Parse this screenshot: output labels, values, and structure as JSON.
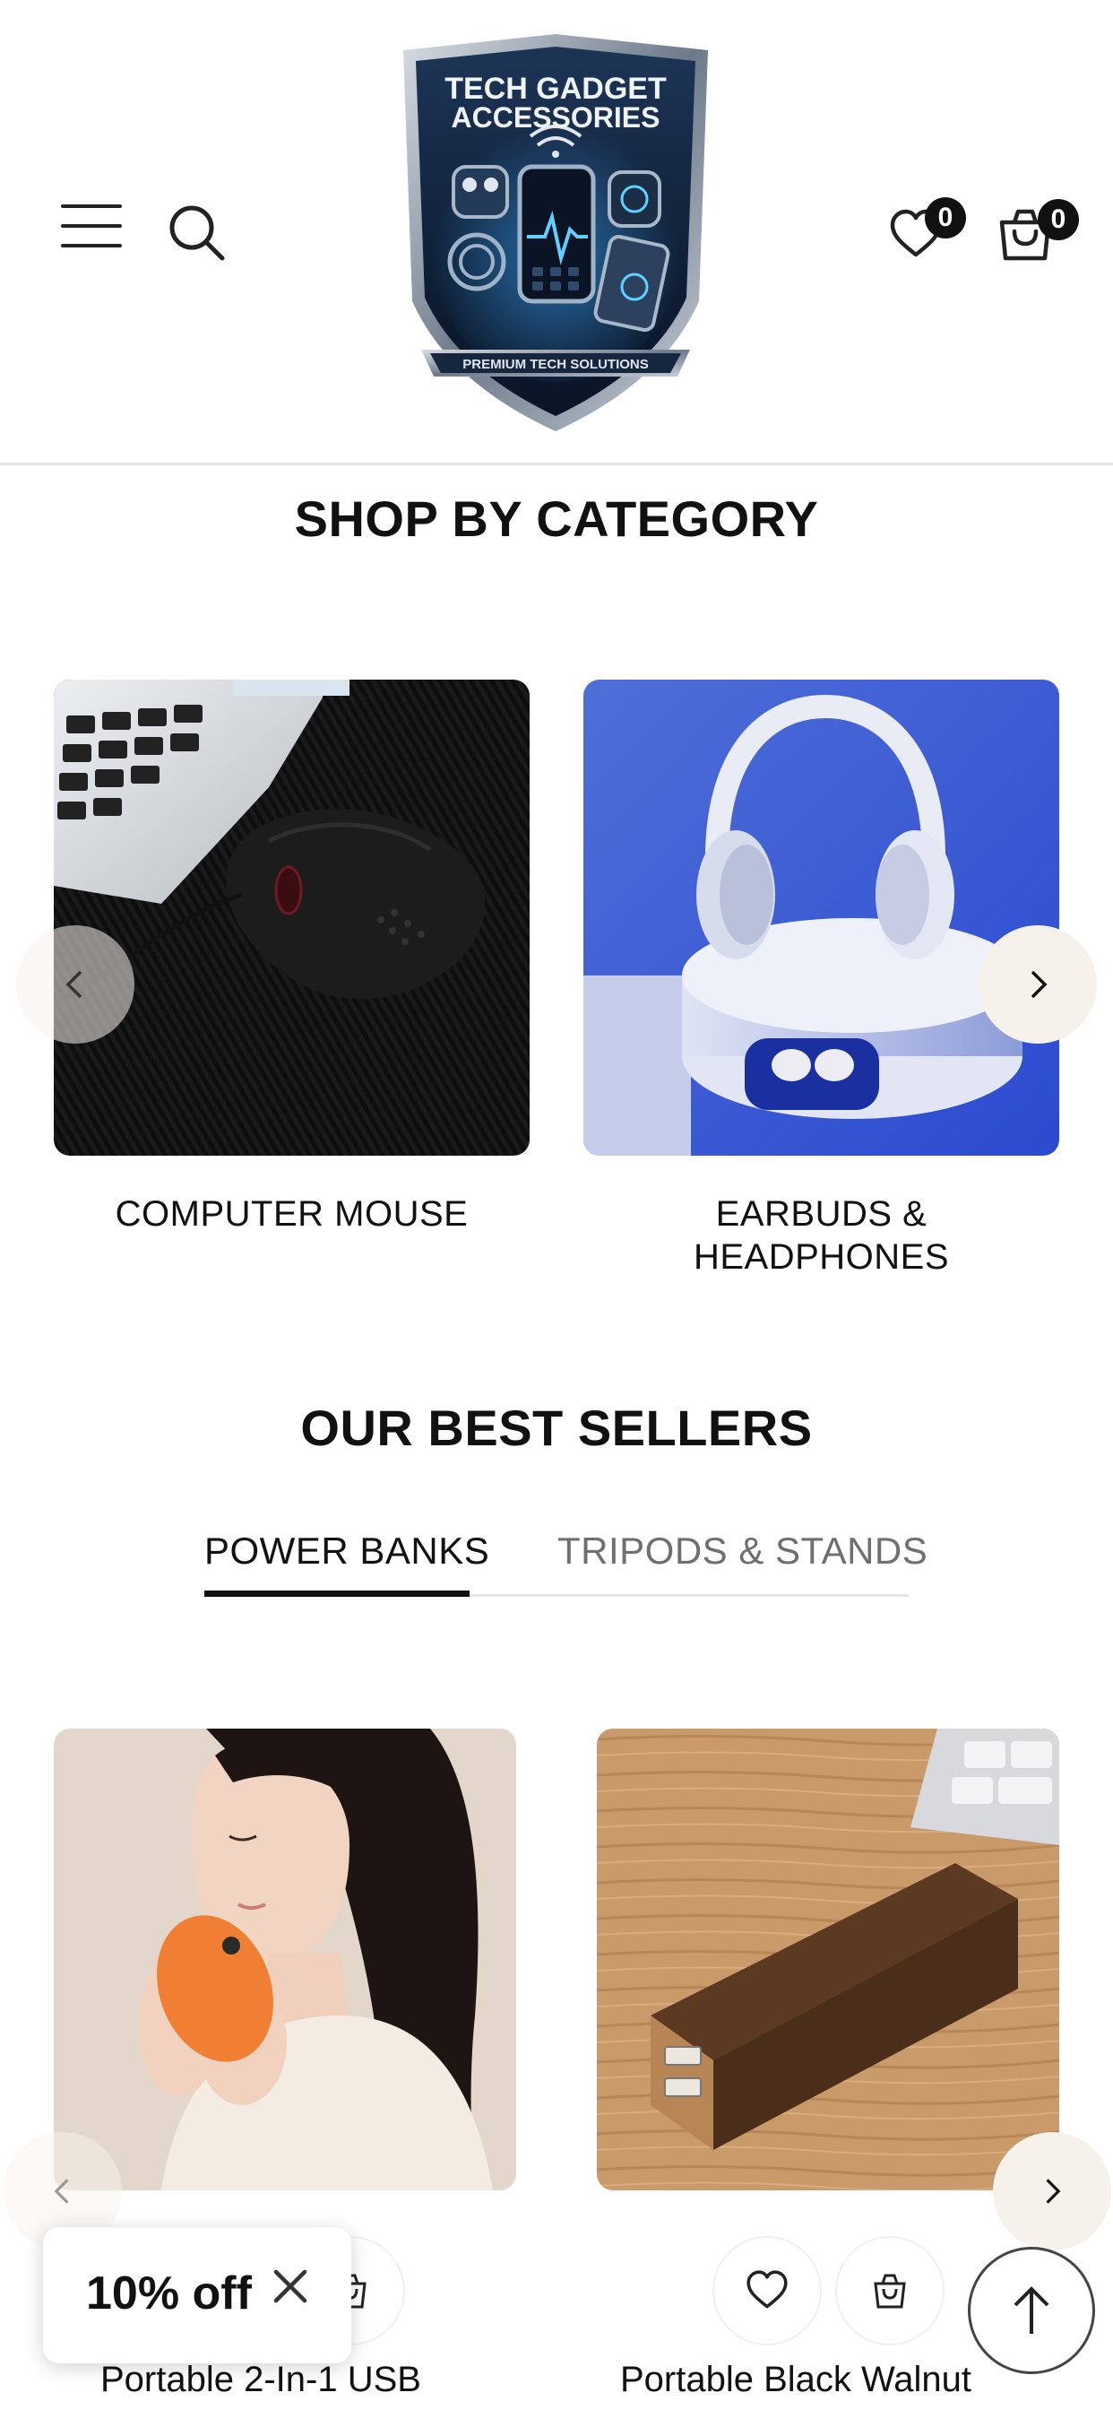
{
  "header": {
    "wishlist_count": "0",
    "cart_count": "0",
    "logo": {
      "line1": "TECH GADGET",
      "line2": "ACCESSORIES",
      "tagline": "PREMIUM TECH SOLUTIONS"
    }
  },
  "categories": {
    "title": "SHOP BY CATEGORY",
    "items": [
      {
        "label": "COMPUTER MOUSE"
      },
      {
        "label_line1": "EARBUDS &",
        "label_line2": "HEADPHONES"
      }
    ]
  },
  "best_sellers": {
    "title": "OUR BEST SELLERS",
    "tabs": [
      {
        "label": "POWER BANKS",
        "active": true
      },
      {
        "label": "TRIPODS & STANDS",
        "active": false
      }
    ],
    "products": [
      {
        "title": "Portable 2-In-1 USB"
      },
      {
        "title": "Portable Black Walnut"
      }
    ]
  },
  "promo": {
    "text": "10% off"
  },
  "colors": {
    "text": "#111111",
    "muted_tab": "#6f6f6f",
    "nav_circle": "#f7f1ec",
    "divider": "#e6e6e6"
  },
  "icons": [
    "menu-icon",
    "search-icon",
    "heart-icon",
    "cart-icon",
    "chevron-left-icon",
    "chevron-right-icon",
    "close-icon",
    "arrow-up-icon",
    "bag-icon"
  ]
}
